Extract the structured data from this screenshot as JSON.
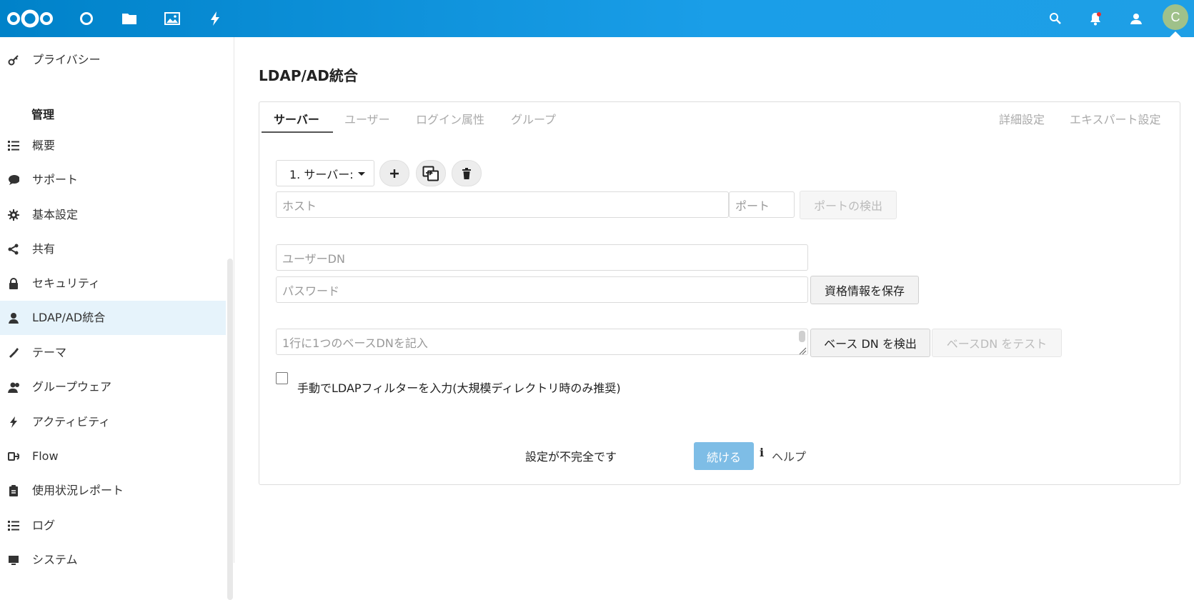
{
  "header": {
    "avatar_letter": "C",
    "accent_color": "#0082c9",
    "nav_icons": [
      "nextcloud-logo",
      "dashboard-icon",
      "files-icon",
      "photos-icon",
      "activity-icon"
    ],
    "right_icons": [
      "search-icon",
      "notifications-icon",
      "contacts-icon"
    ]
  },
  "sidebar": {
    "top_item": "プライバシー",
    "section_title": "管理",
    "items": [
      {
        "label": "概要",
        "icon": "list-icon"
      },
      {
        "label": "サポート",
        "icon": "speech-bubble-icon"
      },
      {
        "label": "基本設定",
        "icon": "gear-icon"
      },
      {
        "label": "共有",
        "icon": "share-icon"
      },
      {
        "label": "セキュリティ",
        "icon": "lock-icon"
      },
      {
        "label": "LDAP/AD統合",
        "icon": "user-icon",
        "active": true
      },
      {
        "label": "テーマ",
        "icon": "paint-brush-icon"
      },
      {
        "label": "グループウェア",
        "icon": "group-icon"
      },
      {
        "label": "アクティビティ",
        "icon": "lightning-icon"
      },
      {
        "label": "Flow",
        "icon": "flow-icon"
      },
      {
        "label": "使用状況レポート",
        "icon": "clipboard-icon"
      },
      {
        "label": "ログ",
        "icon": "list-icon"
      },
      {
        "label": "システム",
        "icon": "system-icon"
      }
    ]
  },
  "main": {
    "title": "LDAP/AD統合",
    "tabs_left": [
      "サーバー",
      "ユーザー",
      "ログイン属性",
      "グループ"
    ],
    "tabs_right": [
      "詳細設定",
      "エキスパート設定"
    ],
    "server_select": "1. サーバー:",
    "host_placeholder": "ホスト",
    "port_placeholder": "ポート",
    "detect_port": "ポートの検出",
    "user_dn_placeholder": "ユーザーDN",
    "password_placeholder": "パスワード",
    "save_credentials": "資格情報を保存",
    "base_dn_placeholder": "1行に1つのベースDNを記入",
    "detect_base_dn": "ベース DN を検出",
    "test_base_dn": "ベースDN をテスト",
    "manual_filter_label": "手動でLDAPフィルターを入力(大規模ディレクトリ時のみ推奨)",
    "status": "設定が不完全です",
    "continue": "続ける",
    "help": "ヘルプ"
  }
}
